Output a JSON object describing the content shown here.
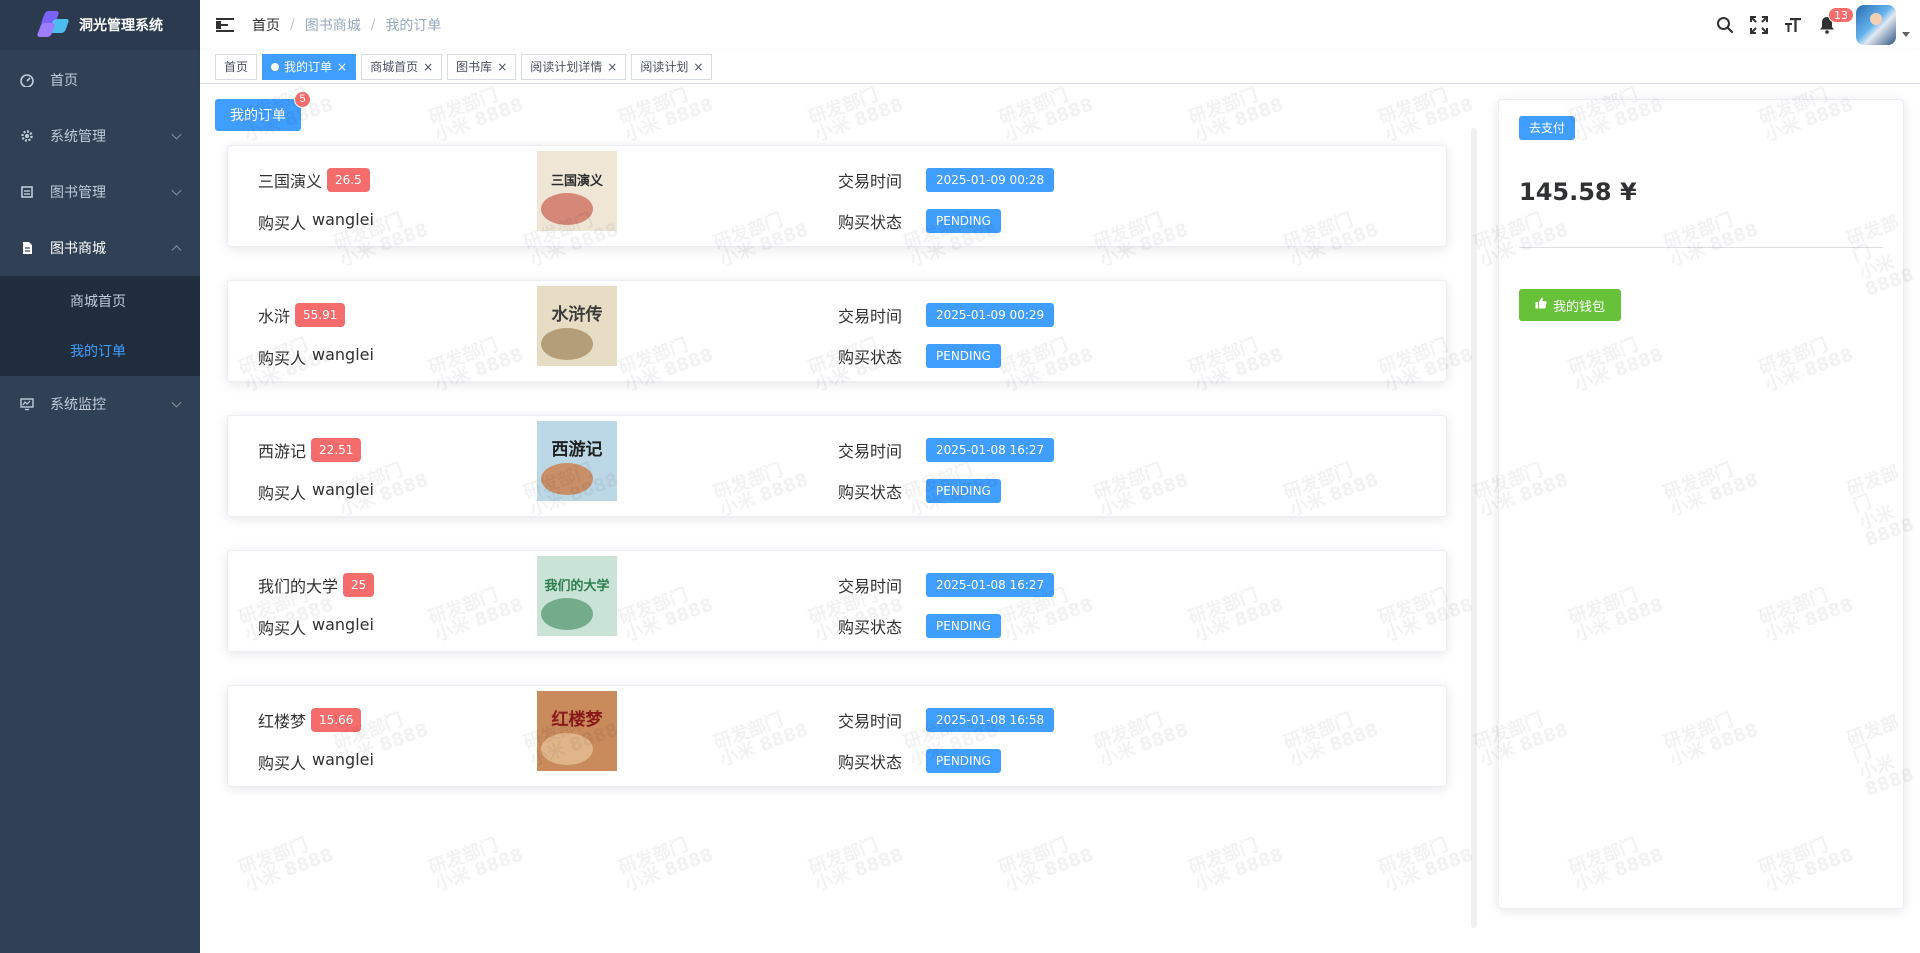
{
  "app": {
    "title": "洞光管理系统"
  },
  "sidebar": {
    "items": [
      {
        "label": "首页",
        "icon": "dashboard-icon"
      },
      {
        "label": "系统管理",
        "icon": "gear-icon"
      },
      {
        "label": "图书管理",
        "icon": "book-icon"
      },
      {
        "label": "图书商城",
        "icon": "document-icon"
      },
      {
        "label": "系统监控",
        "icon": "monitor-icon"
      }
    ],
    "submenu": [
      {
        "label": "商城首页"
      },
      {
        "label": "我的订单"
      }
    ]
  },
  "breadcrumb": [
    "首页",
    "图书商城",
    "我的订单"
  ],
  "breadcrumb_sep": "/",
  "navbar": {
    "notifications": "13"
  },
  "tags": [
    {
      "label": "首页"
    },
    {
      "label": "我的订单"
    },
    {
      "label": "商城首页"
    },
    {
      "label": "图书库"
    },
    {
      "label": "阅读计划详情"
    },
    {
      "label": "阅读计划"
    }
  ],
  "tag_close": "×",
  "main": {
    "my_orders_label": "我的订单",
    "my_orders_count": "5",
    "buyer_label": "购买人",
    "time_label": "交易时间",
    "status_label": "购买状态"
  },
  "orders": [
    {
      "title": "三国演义",
      "price": "26.5",
      "buyer": "wanglei",
      "time": "2025-01-09 00:28",
      "status": "PENDING"
    },
    {
      "title": "水浒",
      "price": "55.91",
      "buyer": "wanglei",
      "time": "2025-01-09 00:29",
      "status": "PENDING"
    },
    {
      "title": "西游记",
      "price": "22.51",
      "buyer": "wanglei",
      "time": "2025-01-08 16:27",
      "status": "PENDING"
    },
    {
      "title": "我们的大学",
      "price": "25",
      "buyer": "wanglei",
      "time": "2025-01-08 16:27",
      "status": "PENDING"
    },
    {
      "title": "红楼梦",
      "price": "15.66",
      "buyer": "wanglei",
      "time": "2025-01-08 16:58",
      "status": "PENDING"
    }
  ],
  "covers": [
    {
      "text": "三国演义",
      "bg": "#efe6d6",
      "fg": "#2b2b2b",
      "accent": "#c0392b"
    },
    {
      "text": "水浒传",
      "bg": "#e7dcc4",
      "fg": "#3b3b3b",
      "accent": "#8b6b3d"
    },
    {
      "text": "西游记",
      "bg": "#bcd7e6",
      "fg": "#1f1f1f",
      "accent": "#d35400"
    },
    {
      "text": "我们的大学",
      "bg": "#c9e3d6",
      "fg": "#2e7d4f",
      "accent": "#2e7d4f"
    },
    {
      "text": "红楼梦",
      "bg": "#c98a5c",
      "fg": "#8b1a1a",
      "accent": "#f3d9b0"
    }
  ],
  "wallet": {
    "pay_label": "去支付",
    "amount": "145.58 ¥",
    "wallet_button_label": "我的钱包"
  },
  "watermark": {
    "text": "研发部门",
    "code": "小米 8888"
  },
  "colors": {
    "sidebar_bg": "#304156",
    "primary": "#409eff",
    "danger": "#f56c6c",
    "success": "#67c23a"
  }
}
